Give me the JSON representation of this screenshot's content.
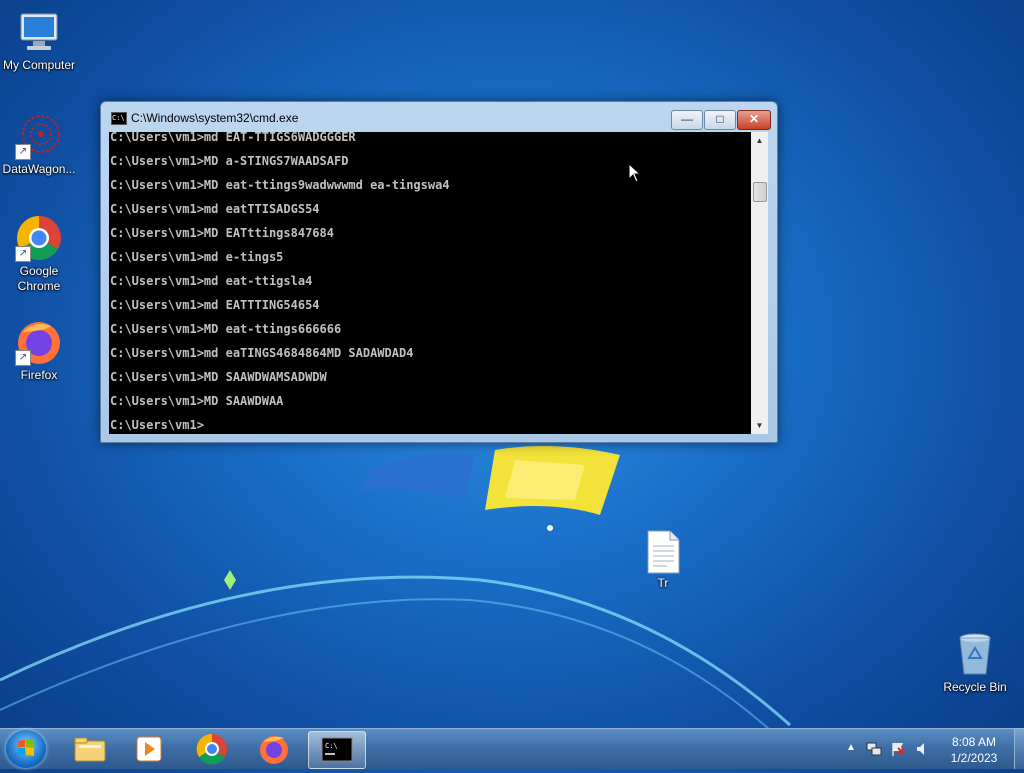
{
  "desktop": {
    "icons": [
      {
        "label": "My Computer",
        "icon": "computer-icon"
      },
      {
        "label": "DataWagon...",
        "icon": "datawagon-icon"
      },
      {
        "label": "Google Chrome",
        "icon": "chrome-icon"
      },
      {
        "label": "Firefox",
        "icon": "firefox-icon"
      },
      {
        "label": "Tr",
        "icon": "text-file-icon"
      },
      {
        "label": "Recycle Bin",
        "icon": "recycle-bin-icon"
      }
    ]
  },
  "cmd": {
    "title": "C:\\Windows\\system32\\cmd.exe",
    "buttons": {
      "minimize": "—",
      "maximize": "□",
      "close": "✕"
    },
    "lines": [
      "C:\\Users\\vm1>md EAT-TTIGS6WADGGGER",
      "C:\\Users\\vm1>MD a-STINGS7WAADSAFD",
      "C:\\Users\\vm1>MD eat-ttings9wadwwwmd ea-tingswa4",
      "C:\\Users\\vm1>md eatTTISADGS54",
      "C:\\Users\\vm1>MD EATttings847684",
      "C:\\Users\\vm1>md e-tings5",
      "C:\\Users\\vm1>md eat-ttigsla4",
      "C:\\Users\\vm1>md EATTTING54654",
      "C:\\Users\\vm1>MD eat-ttings666666",
      "C:\\Users\\vm1>md eaTINGS4684864MD SADAWDAD4",
      "C:\\Users\\vm1>MD SAAWDWAMSADWDW",
      "C:\\Users\\vm1>MD SAAWDWAA",
      "C:\\Users\\vm1>"
    ]
  },
  "taskbar": {
    "pinned": [
      "start-orb-icon",
      "file-explorer-icon",
      "media-player-icon",
      "chrome-icon",
      "firefox-icon",
      "cmd-icon"
    ],
    "clock": {
      "time": "8:08 AM",
      "date": "1/2/2023"
    }
  },
  "colors": {
    "console_bg": "#000000",
    "console_fg": "#c0c0c0",
    "taskbar": "#3f6fa6",
    "close_button": "#c8422c"
  }
}
